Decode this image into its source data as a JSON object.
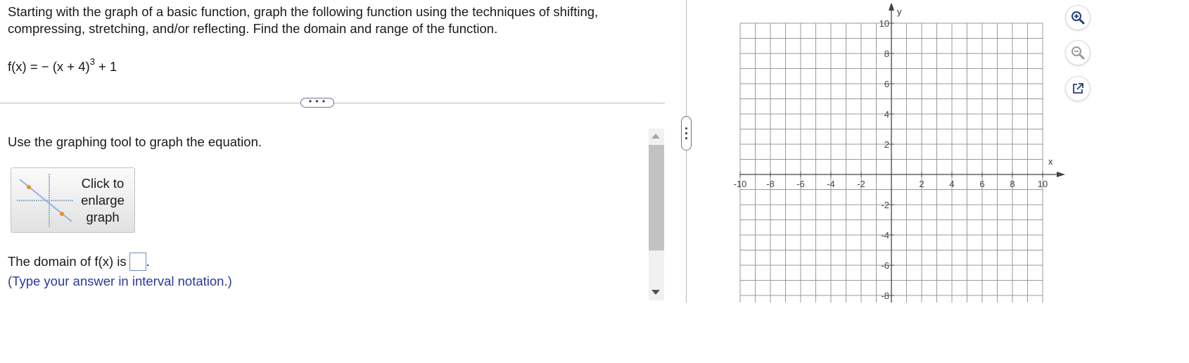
{
  "problem": {
    "line1": "Starting with the graph of a basic function, graph the following function using the techniques of shifting,",
    "line2": "compressing, stretching, and/or reflecting. Find the domain and range of the function.",
    "formula_lhs": "f(x) = − (x + 4)",
    "formula_exp": "3",
    "formula_rhs": " + 1"
  },
  "more_button": "• • •",
  "instruction": "Use the graphing tool to graph the equation.",
  "enlarge_button": {
    "line1": "Click to",
    "line2": "enlarge",
    "line3": "graph"
  },
  "domain": {
    "label": "The domain of f(x) is",
    "after": ".",
    "answer": ""
  },
  "hint": "(Type your answer in interval notation.)",
  "graph": {
    "x_axis_label": "x",
    "y_axis_label": "y",
    "x_tick_labels": [
      "-10",
      "-8",
      "-6",
      "-4",
      "-2",
      "2",
      "4",
      "6",
      "8",
      "10"
    ],
    "y_tick_labels": [
      "10",
      "8",
      "6",
      "4",
      "2",
      "-2",
      "-4",
      "-6",
      "-8"
    ],
    "x_range": [
      -10,
      10
    ],
    "y_range": [
      -10,
      10
    ],
    "grid": true,
    "grid_color": "#999999"
  },
  "tools": {
    "zoom_in": "zoom-in-icon",
    "zoom_out": "zoom-out-icon",
    "popout": "popout-icon"
  },
  "colors": {
    "accent": "#2b3a9b",
    "icon_blue": "#23407a"
  }
}
